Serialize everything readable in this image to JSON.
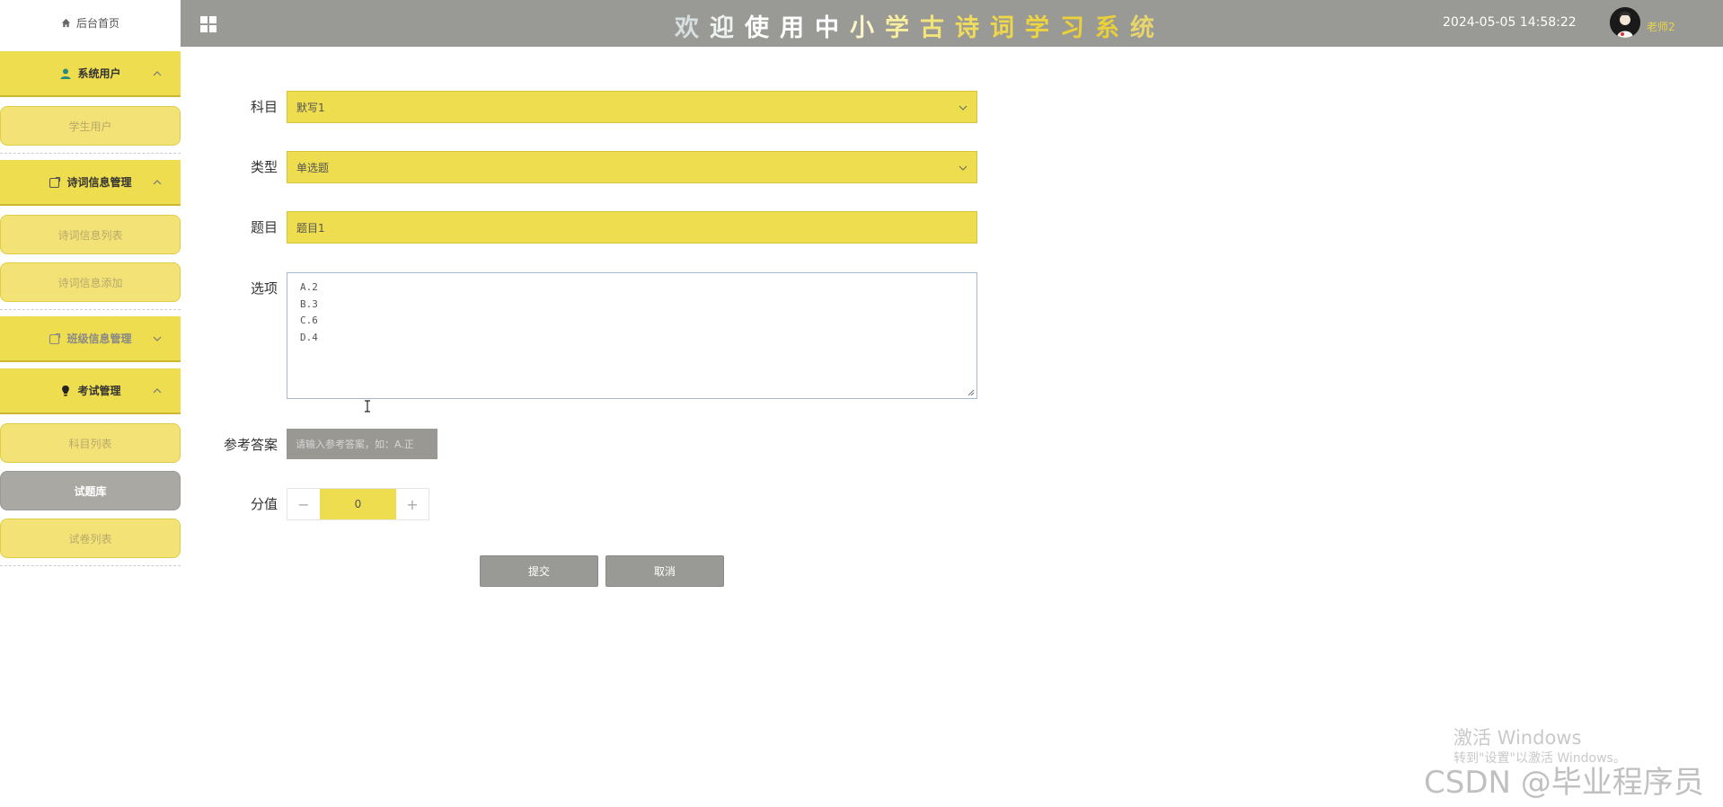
{
  "sidebar": {
    "home_label": "后台首页",
    "groups": [
      {
        "label": "系统用户",
        "icon": "user-icon",
        "expanded": true,
        "items": [
          {
            "label": "学生用户",
            "active": false
          }
        ]
      },
      {
        "label": "诗词信息管理",
        "icon": "edit-icon",
        "expanded": true,
        "items": [
          {
            "label": "诗词信息列表",
            "active": false
          },
          {
            "label": "诗词信息添加",
            "active": false
          }
        ]
      },
      {
        "label": "班级信息管理",
        "icon": "edit-icon",
        "expanded": false,
        "items": []
      },
      {
        "label": "考试管理",
        "icon": "bulb-icon",
        "expanded": true,
        "items": [
          {
            "label": "科目列表",
            "active": false
          },
          {
            "label": "试题库",
            "active": true
          },
          {
            "label": "试卷列表",
            "active": false
          }
        ]
      }
    ]
  },
  "header": {
    "title": "欢迎使用中小学古诗词学习系统",
    "datetime": "2024-05-05 14:58:22",
    "username": "老师2"
  },
  "form": {
    "subject": {
      "label": "科目",
      "value": "默写1"
    },
    "type": {
      "label": "类型",
      "value": "单选题"
    },
    "question": {
      "label": "题目",
      "value": "题目1"
    },
    "options": {
      "label": "选项",
      "lines": [
        "A.2",
        "B.3",
        "C.6",
        "D.4"
      ]
    },
    "answer": {
      "label": "参考答案",
      "placeholder": "请输入参考答案，如：A.正"
    },
    "score": {
      "label": "分值",
      "value": "0"
    },
    "submit_label": "提交",
    "cancel_label": "取消"
  },
  "watermark": {
    "activate_title": "激活 Windows",
    "activate_sub": "转到\"设置\"以激活 Windows。",
    "csdn": "CSDN @毕业程序员"
  },
  "colors": {
    "accent": "#efdd50",
    "header_bg": "#999995",
    "active_item": "#aaa8a3"
  }
}
